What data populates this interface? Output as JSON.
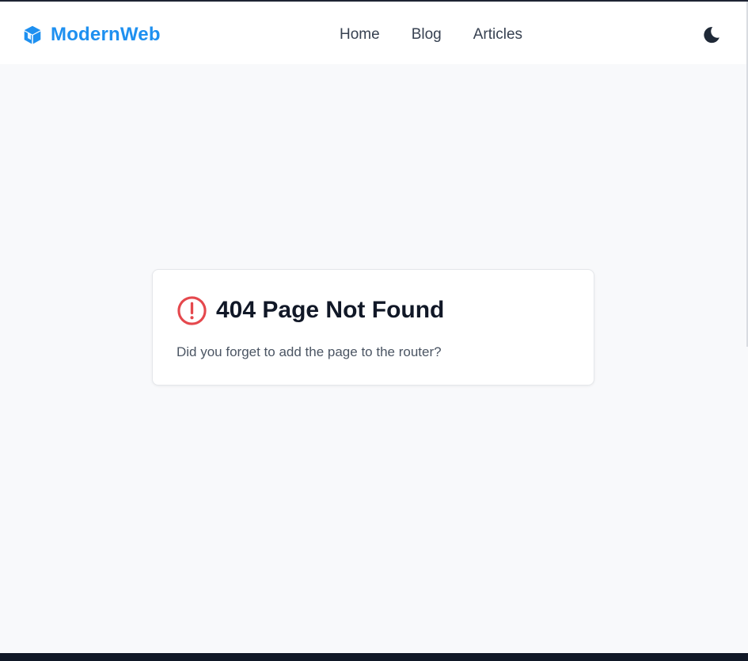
{
  "brand": {
    "name": "ModernWeb",
    "icon": "cube-icon",
    "color": "#1e90f0"
  },
  "nav": {
    "links": [
      "Home",
      "Blog",
      "Articles"
    ]
  },
  "theme_toggle": {
    "icon": "moon-icon"
  },
  "error_card": {
    "icon": "exclamation-circle-icon",
    "icon_color": "#e5484d",
    "title": "404 Page Not Found",
    "message": "Did you forget to add the page to the router?"
  },
  "colors": {
    "background": "#f8f9fb",
    "text_primary": "#111827",
    "text_secondary": "#4b5563",
    "footer_bar": "#111827"
  }
}
